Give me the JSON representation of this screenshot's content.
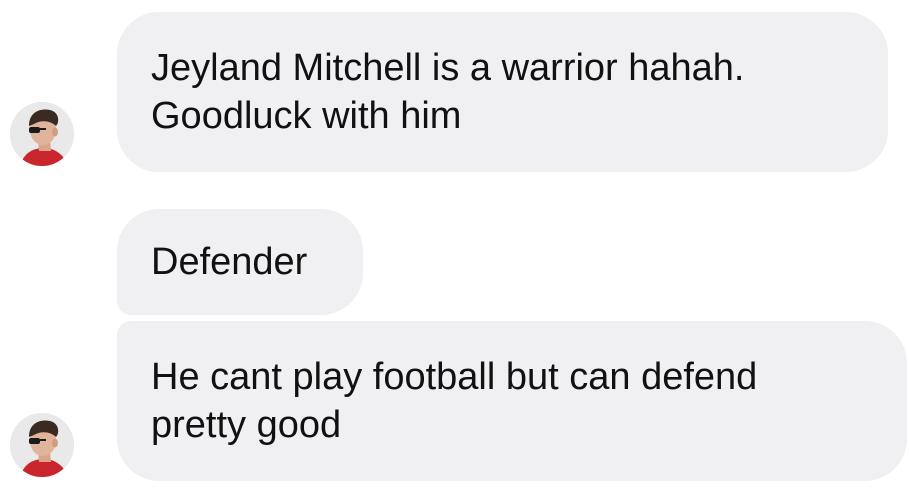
{
  "messages": [
    {
      "lines": [
        "Jeyland Mitchell is a warrior hahah.",
        "Goodluck with him"
      ],
      "has_avatar": true
    },
    {
      "lines": [
        "Defender"
      ],
      "has_avatar": false
    },
    {
      "lines": [
        "He cant play football but can defend",
        "pretty good"
      ],
      "has_avatar": true
    }
  ],
  "colors": {
    "bubble_background": "#f0f0f3",
    "text": "#111111",
    "page_background": "#ffffff"
  },
  "icons": {
    "avatar": "sender-avatar-photo"
  }
}
